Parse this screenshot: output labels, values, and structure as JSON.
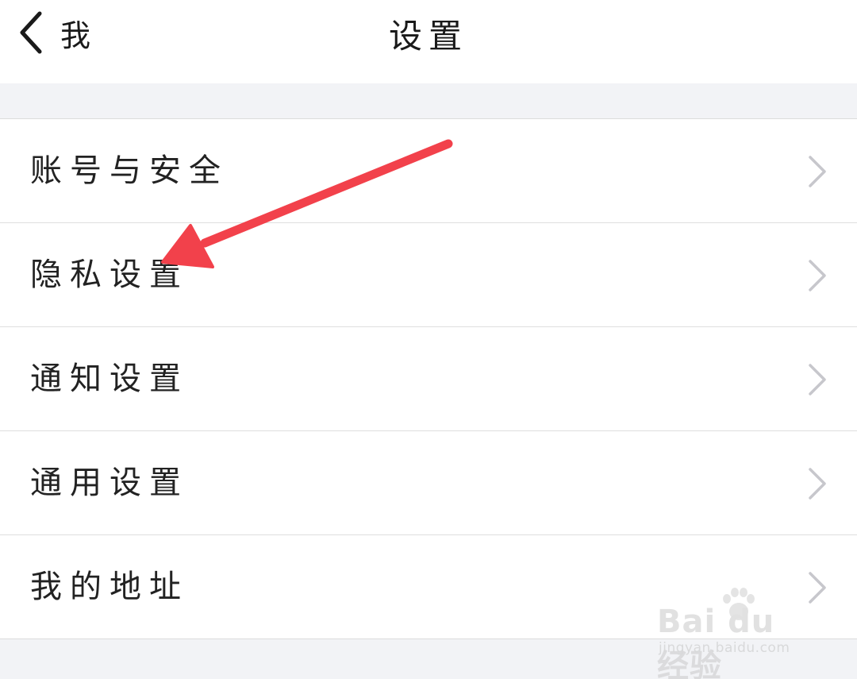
{
  "navbar": {
    "back_label": "我",
    "title": "设置"
  },
  "settings": {
    "items": [
      {
        "label": "账号与安全"
      },
      {
        "label": "隐私设置"
      },
      {
        "label": "通知设置"
      },
      {
        "label": "通用设置"
      },
      {
        "label": "我的地址"
      }
    ]
  },
  "watermark": {
    "logo_text": "Bai du 经验",
    "url": "jingyan.baidu.com"
  },
  "colors": {
    "annotation_arrow": "#f2414b",
    "chevron": "#c7c7cc",
    "background": "#f2f3f6",
    "row_background": "#ffffff"
  }
}
